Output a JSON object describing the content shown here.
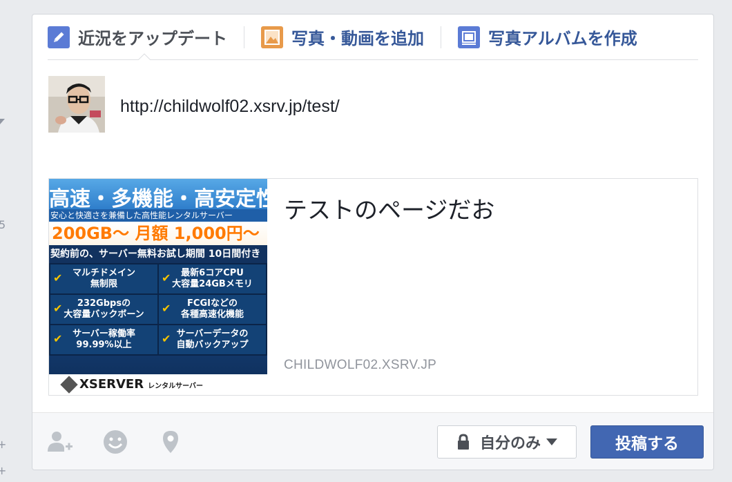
{
  "edge_marks": [
    "5",
    "+",
    "+"
  ],
  "tabs": [
    {
      "label": "近況をアップデート",
      "icon": "pencil-icon"
    },
    {
      "label": "写真・動画を追加",
      "icon": "photo-icon"
    },
    {
      "label": "写真アルバムを作成",
      "icon": "album-icon"
    }
  ],
  "status": {
    "value": "http://childwolf02.xsrv.jp/test/"
  },
  "link_preview": {
    "title": "テストのページだお",
    "domain": "CHILDWOLF02.XSRV.JP",
    "thumbnail": {
      "headline": "高速・多機能・高安定性",
      "subline": "安心と快適さを兼備した高性能レンタルサーバー",
      "price": "200GB〜 月額 1,000円〜",
      "trial": "契約前の、サーバー無料お試し期間 10日間付き",
      "features": [
        "マルチドメイン\n無制限",
        "最新6コアCPU\n大容量24GBメモリ",
        "232Gbpsの\n大容量バックボーン",
        "FCGIなどの\n各種高速化機能",
        "サーバー稼働率\n99.99%以上",
        "サーバーデータの\n自動バックアップ"
      ],
      "brand": "XSERVER",
      "brand_sub": "レンタルサーバー"
    }
  },
  "footer": {
    "icons": [
      "tag-friends-icon",
      "feeling-icon",
      "location-icon"
    ],
    "privacy_label": "自分のみ",
    "post_label": "投稿する"
  },
  "colors": {
    "primary": "#4267b2",
    "link": "#365899",
    "background": "#e9ebee"
  }
}
